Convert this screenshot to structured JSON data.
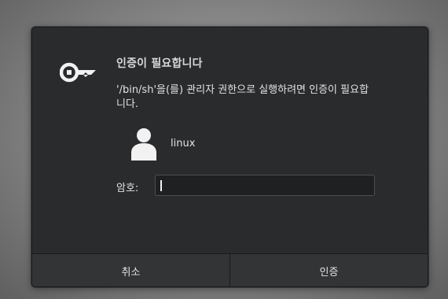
{
  "dialog": {
    "title": "인증이 필요합니다",
    "message_line1": "'/bin/sh'을(를) 관리자 권한으로 실행하려면 인증이 필요합",
    "message_line2": "니다.",
    "icon": "key-icon",
    "user": {
      "avatar_icon": "user-avatar-icon",
      "name": "linux"
    },
    "password": {
      "label": "암호:",
      "value": ""
    },
    "buttons": {
      "cancel": "취소",
      "authenticate": "인증"
    }
  }
}
